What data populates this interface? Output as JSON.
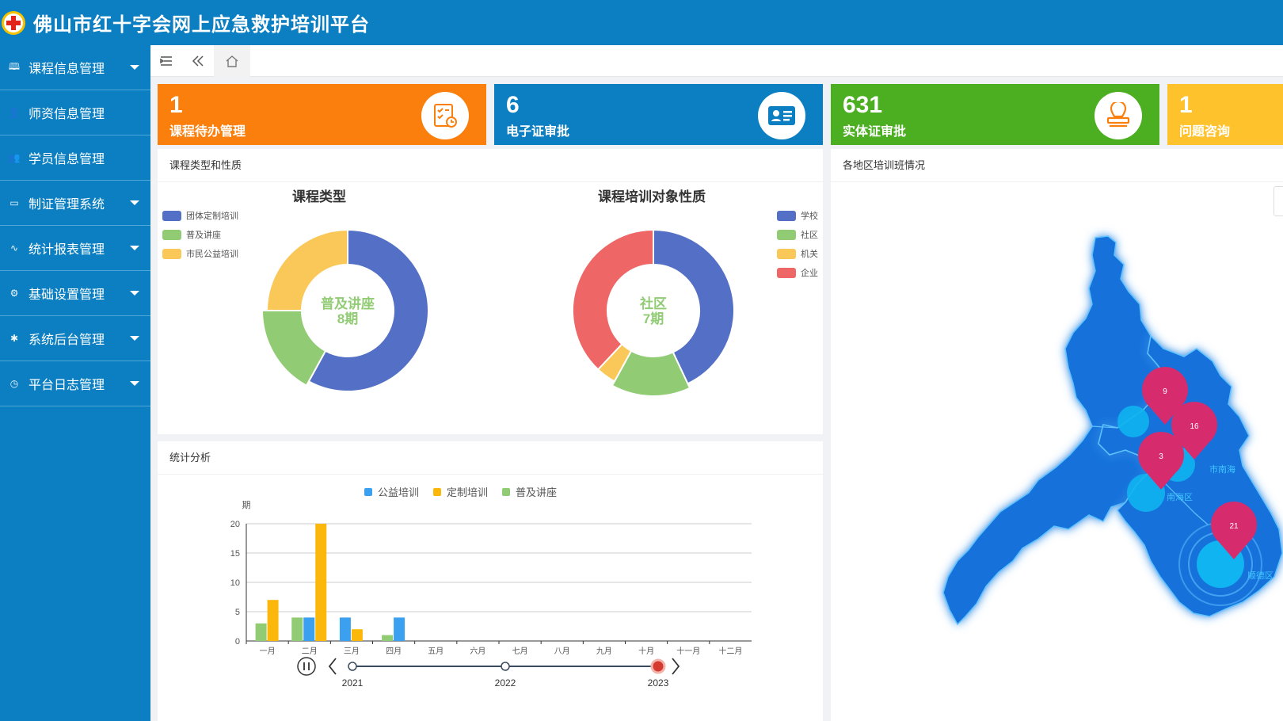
{
  "app": {
    "title": "佛山市红十字会网上应急救护培训平台"
  },
  "sidebar": {
    "items": [
      {
        "label": "课程信息管理",
        "icon": "book-icon",
        "glyph": "🕮",
        "has_dropdown": true
      },
      {
        "label": "师资信息管理",
        "icon": "user-icon",
        "glyph": "👤",
        "has_dropdown": false
      },
      {
        "label": "学员信息管理",
        "icon": "users-icon",
        "glyph": "👥",
        "has_dropdown": false
      },
      {
        "label": "制证管理系统",
        "icon": "id-card-icon",
        "glyph": "▭",
        "has_dropdown": true
      },
      {
        "label": "统计报表管理",
        "icon": "pulse-icon",
        "glyph": "∿",
        "has_dropdown": true
      },
      {
        "label": "基础设置管理",
        "icon": "gear-icon",
        "glyph": "⚙",
        "has_dropdown": true
      },
      {
        "label": "系统后台管理",
        "icon": "cog-icon",
        "glyph": "✱",
        "has_dropdown": true
      },
      {
        "label": "平台日志管理",
        "icon": "clock-icon",
        "glyph": "◷",
        "has_dropdown": true
      }
    ]
  },
  "toolbar": {
    "menu_icon": "menu-collapse-icon",
    "back_icon": "double-chevron-left-icon",
    "home_icon": "home-icon"
  },
  "cards": [
    {
      "value": "1",
      "label": "课程待办管理",
      "color": "#fa7f0c",
      "icon": "schedule-check-icon"
    },
    {
      "value": "6",
      "label": "电子证审批",
      "color": "#0b7fc1",
      "icon": "id-card-icon"
    },
    {
      "value": "631",
      "label": "实体证审批",
      "color": "#4caf22",
      "icon": "stamp-icon"
    },
    {
      "value": "1",
      "label": "问题咨询",
      "color": "#fec22c",
      "icon": "question-icon"
    }
  ],
  "course_panel": {
    "title": "课程类型和性质",
    "chart1_title": "课程类型",
    "chart2_title": "课程培训对象性质",
    "center1_line1": "普及讲座",
    "center1_line2": "8期",
    "center2_line1": "社区",
    "center2_line2": "7期"
  },
  "stats_panel": {
    "title": "统计分析"
  },
  "map_panel": {
    "title": "各地区培训班情况"
  },
  "chart_data": [
    {
      "type": "pie",
      "title": "课程类型",
      "labels": [
        "团体定制培训",
        "普及讲座",
        "市民公益培训"
      ],
      "values": [
        58,
        17,
        25
      ],
      "colors": [
        "#5470c6",
        "#91cc75",
        "#fac858"
      ],
      "highlight": {
        "label": "普及讲座",
        "value": "8期"
      }
    },
    {
      "type": "pie",
      "title": "课程培训对象性质",
      "labels": [
        "学校",
        "社区",
        "机关",
        "企业"
      ],
      "values": [
        43,
        15,
        4,
        38
      ],
      "colors": [
        "#5470c6",
        "#91cc75",
        "#fac858",
        "#ee6666"
      ],
      "highlight": {
        "label": "社区",
        "value": "7期"
      }
    },
    {
      "type": "bar",
      "categories": [
        "一月",
        "二月",
        "三月",
        "四月",
        "五月",
        "六月",
        "七月",
        "八月",
        "九月",
        "十月",
        "十一月",
        "十二月"
      ],
      "series": [
        {
          "name": "公益培训",
          "color": "#3ba0f0",
          "values": [
            0,
            4,
            4,
            4,
            0,
            0,
            0,
            0,
            0,
            0,
            0,
            0
          ]
        },
        {
          "name": "定制培训",
          "color": "#fbb80a",
          "values": [
            7,
            20,
            2,
            0,
            0,
            0,
            0,
            0,
            0,
            0,
            0,
            0
          ]
        },
        {
          "name": "普及讲座",
          "color": "#91cc75",
          "values": [
            3,
            4,
            0,
            1,
            0,
            0,
            0,
            0,
            0,
            0,
            0,
            0
          ]
        }
      ],
      "ylabel": "期",
      "ylim": [
        0,
        20
      ],
      "yticks": [
        0,
        5,
        10,
        15,
        20
      ],
      "timeline": {
        "years": [
          "2021",
          "2022",
          "2023"
        ],
        "selected": "2023"
      }
    }
  ],
  "map": {
    "markers": [
      {
        "value": "9"
      },
      {
        "value": "16"
      },
      {
        "value": "3"
      },
      {
        "value": "21"
      }
    ],
    "area_labels": [
      "市南海",
      "南海区",
      "顺德区"
    ]
  }
}
